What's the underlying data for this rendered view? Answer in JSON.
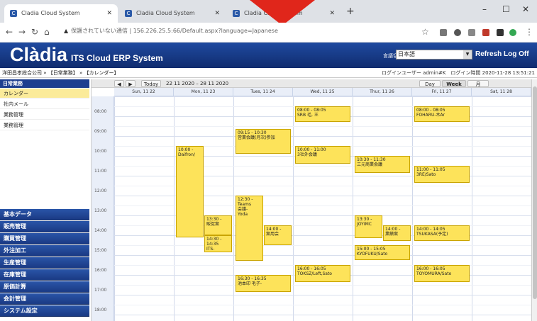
{
  "browser": {
    "tabs": [
      {
        "title": "Cladia Cloud System"
      },
      {
        "title": "Cladia Cloud System"
      },
      {
        "title": "Cladia Cloud System"
      }
    ],
    "url_warning": "保護されていない通信",
    "url": "156.226.25.5:66/Default.aspx?language=Japanese",
    "colors": {
      "arrow": "#e0261b"
    }
  },
  "header": {
    "logo": "Clàdia",
    "subtitle": "ITS Cloud ERP System",
    "language_label": "言語切替",
    "language_value": "日本語",
    "refresh_logoff": "Refresh Log Off"
  },
  "breadcrumb": "洋田昌孝総合公司 » 【日常業務】 » 【カレンダー】",
  "user_info": "ログインユーザー admin#K　ログイン時間 2020-11-28 13:51:21",
  "sidebar": {
    "section": "日常業務",
    "items": [
      {
        "label": "カレンダー",
        "selected": true
      },
      {
        "label": "社内メール",
        "selected": false
      },
      {
        "label": "業務管理",
        "selected": false
      },
      {
        "label": "業務管理",
        "selected": false
      }
    ],
    "categories": [
      "基本データ",
      "販売管理",
      "購買管理",
      "外注加工",
      "生産管理",
      "在庫管理",
      "原価計算",
      "会計管理",
      "システム設定"
    ]
  },
  "calendar": {
    "prev": "◀",
    "next": "▶",
    "today": "Today",
    "range": "22 11 2020 – 28 11 2020",
    "views": [
      "Day",
      "Week",
      "月"
    ],
    "days": [
      "Sun, 11 22",
      "Mon, 11 23",
      "Tues, 11 24",
      "Wed, 11 25",
      "Thur, 11 26",
      "Fri, 11 27",
      "Sat, 11 28"
    ],
    "times": [
      "08:00",
      "09:00",
      "10:00",
      "11:00",
      "12:00",
      "13:00",
      "14:00",
      "15:00",
      "16:00",
      "17:00",
      "18:00"
    ],
    "events": [
      {
        "day": 3,
        "start": 8.0,
        "end": 8.8,
        "text": "08:00 - 08:05\nSRB 毛, 王"
      },
      {
        "day": 5,
        "start": 8.0,
        "end": 8.8,
        "text": "08:00 - 08:05\nFOHARU-木Ar"
      },
      {
        "day": 2,
        "start": 9.15,
        "end": 10.4,
        "text": "09:15 - 10:30\n営業会議(月次)参加"
      },
      {
        "day": 1,
        "start": 10.0,
        "end": 14.6,
        "text": "10:00 -\nDaifron/"
      },
      {
        "day": 3,
        "start": 10.0,
        "end": 10.9,
        "text": "10:00 - 11:00\n3社外会議"
      },
      {
        "day": 4,
        "start": 10.5,
        "end": 11.35,
        "text": "10:30 - 11:30\n三元商業会議"
      },
      {
        "day": 5,
        "start": 11.0,
        "end": 11.85,
        "text": "11:00 - 11:05\n3RE/Sato"
      },
      {
        "day": 2,
        "start": 12.5,
        "end": 15.8,
        "text": "12:30 -\nTeams\n会議-\nYoda"
      },
      {
        "day": 1,
        "start": 13.5,
        "end": 14.5,
        "text": "13:30 -\n販促案"
      },
      {
        "day": 4,
        "start": 13.5,
        "end": 14.65,
        "text": "13:30 -\nJOYIMC"
      },
      {
        "day": 2,
        "start": 14.0,
        "end": 15.0,
        "text": "14:00 -\n案用会"
      },
      {
        "day": 4,
        "start": 14.0,
        "end": 14.8,
        "text": "14:00 -\n業績案"
      },
      {
        "day": 5,
        "start": 14.0,
        "end": 14.8,
        "text": "14:00 - 14:05\nTSUKASA(予定)"
      },
      {
        "day": 1,
        "start": 14.5,
        "end": 15.35,
        "text": "14:30 - 14:35\nITS-Sato,Wendy"
      },
      {
        "day": 4,
        "start": 15.0,
        "end": 15.75,
        "text": "15:00 - 15:05\nKYOFUKU/Sato"
      },
      {
        "day": 3,
        "start": 16.0,
        "end": 16.85,
        "text": "16:00 - 16:05\nTOKSZ/Left,Sato"
      },
      {
        "day": 5,
        "start": 16.0,
        "end": 16.85,
        "text": "16:00 - 16:05\nTOYOMURA/Sato"
      },
      {
        "day": 2,
        "start": 16.5,
        "end": 17.35,
        "text": "16:30 - 16:35\n池本印 毛子-"
      }
    ]
  }
}
